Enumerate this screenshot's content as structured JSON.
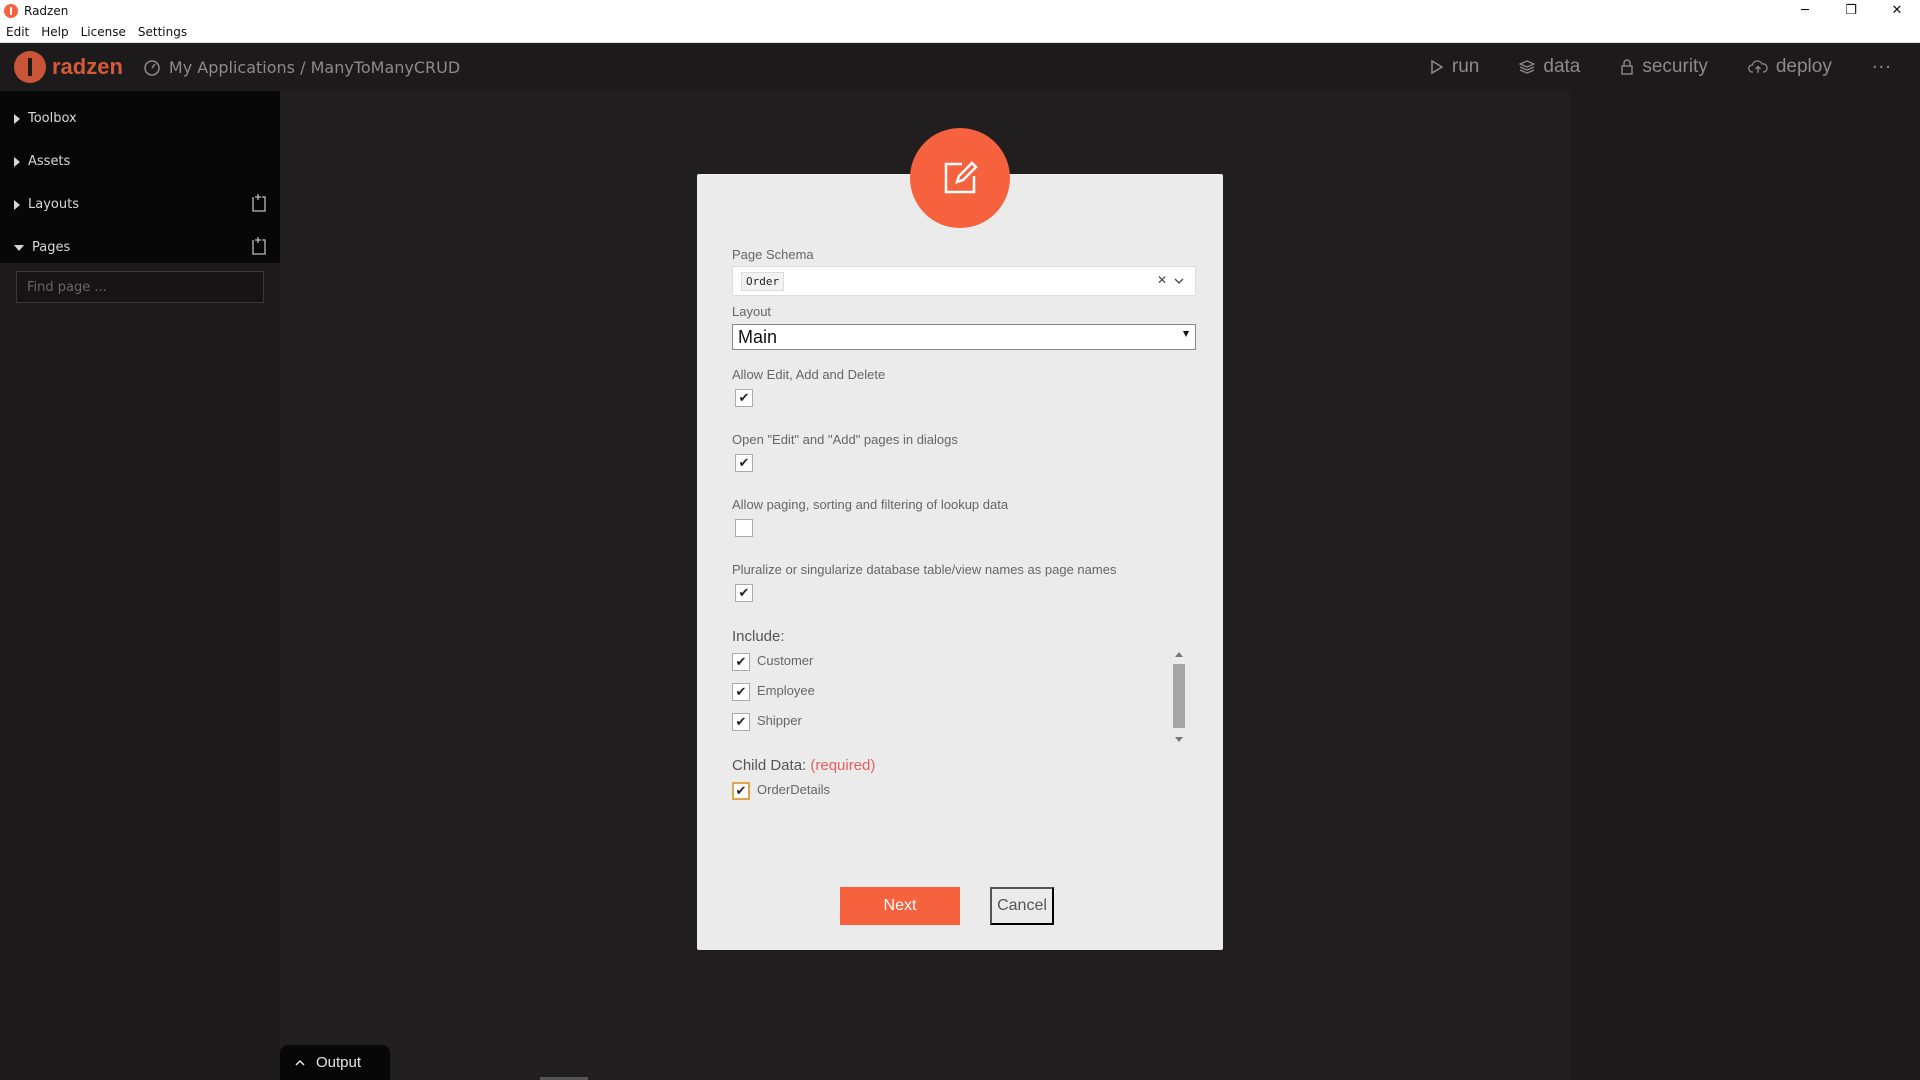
{
  "window": {
    "title": "Radzen",
    "controls": [
      "─",
      "❐",
      "✕"
    ]
  },
  "menubar": {
    "items": [
      "Edit",
      "Help",
      "License",
      "Settings"
    ]
  },
  "header": {
    "logo_text": "radzen",
    "breadcrumb": "My Applications / ManyToManyCRUD",
    "actions": {
      "run": "run",
      "data": "data",
      "security": "security",
      "deploy": "deploy"
    },
    "more": "···"
  },
  "sidebar": {
    "items": [
      {
        "label": "Toolbox"
      },
      {
        "label": "Assets"
      },
      {
        "label": "Layouts"
      },
      {
        "label": "Pages"
      }
    ],
    "search_placeholder": "Find page ..."
  },
  "dialog": {
    "page_schema_label": "Page Schema",
    "page_schema_value": "Order",
    "layout_label": "Layout",
    "layout_value": "Main",
    "options": [
      {
        "label": "Allow Edit, Add and Delete",
        "checked": true
      },
      {
        "label": "Open \"Edit\" and \"Add\" pages in dialogs",
        "checked": true
      },
      {
        "label": "Allow paging, sorting and filtering of lookup data",
        "checked": false
      },
      {
        "label": "Pluralize or singularize database table/view names as page names",
        "checked": true
      }
    ],
    "include_label": "Include:",
    "include_items": [
      {
        "label": "Customer",
        "checked": true
      },
      {
        "label": "Employee",
        "checked": true
      },
      {
        "label": "Shipper",
        "checked": true
      }
    ],
    "child_data_label": "Child Data:",
    "required_label": "(required)",
    "child_items": [
      {
        "label": "OrderDetails",
        "checked": true
      }
    ],
    "next_label": "Next",
    "cancel_label": "Cancel"
  },
  "output": {
    "label": "Output"
  },
  "colors": {
    "accent": "#f5623d",
    "background": "#201e1e",
    "dialog": "#ebebeb"
  }
}
